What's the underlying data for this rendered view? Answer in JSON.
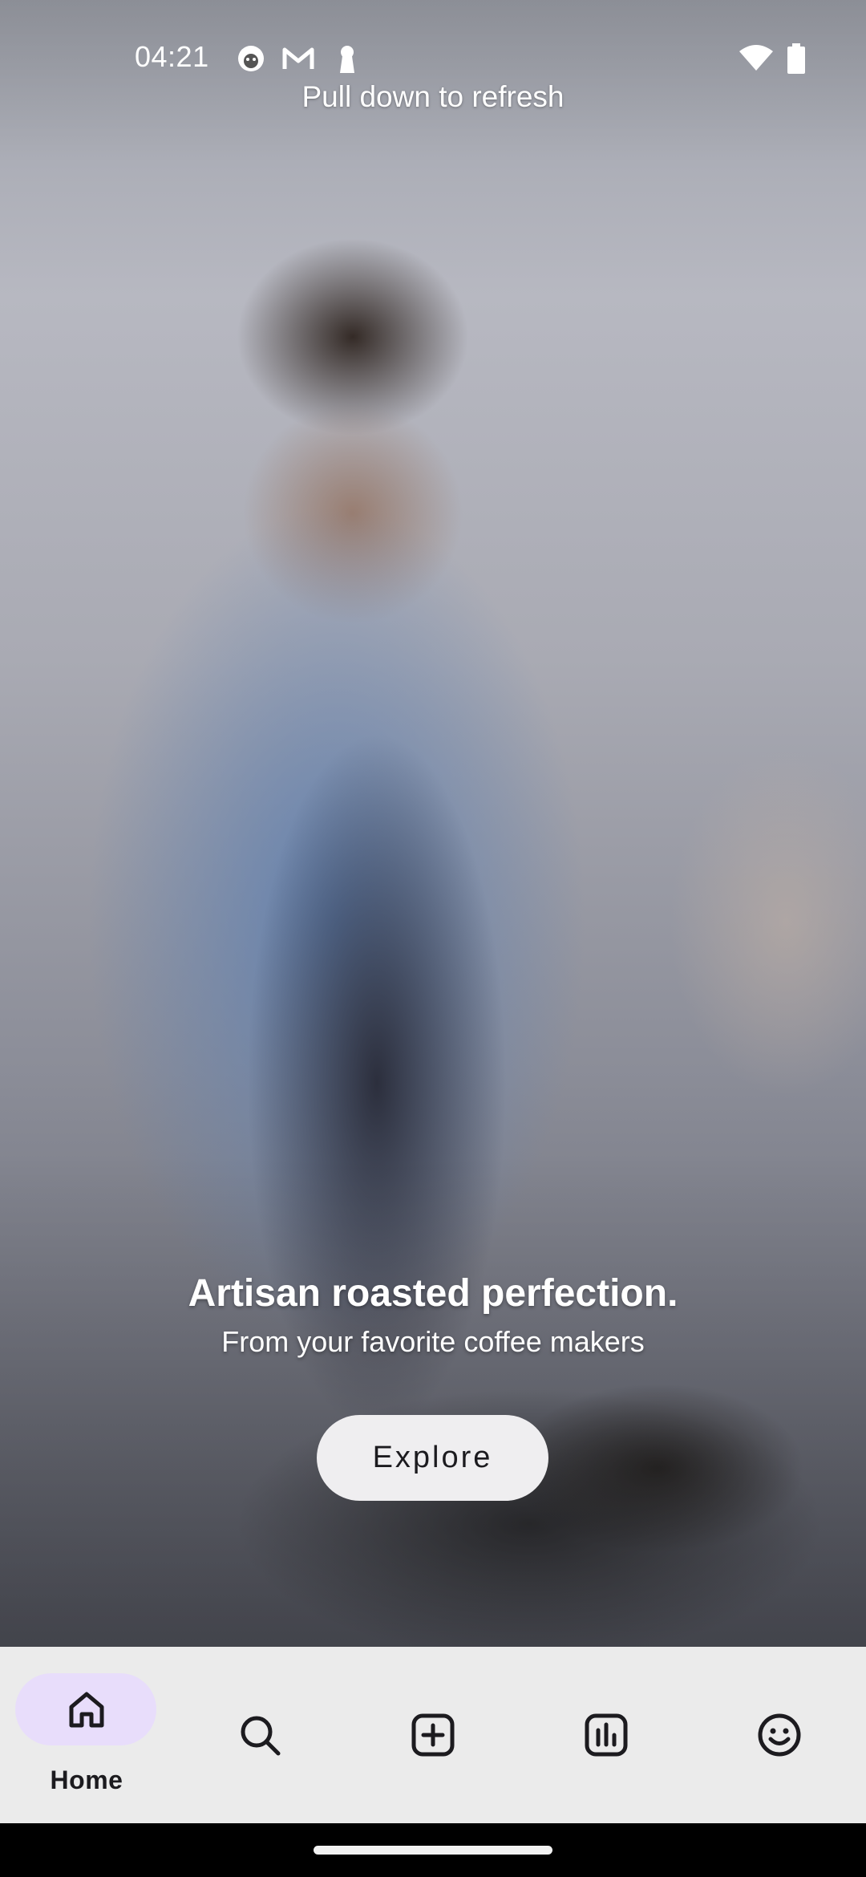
{
  "status_bar": {
    "time": "04:21",
    "icons": [
      "app-notification-icon",
      "gmail-icon",
      "keyhole-icon",
      "wifi-icon",
      "battery-icon"
    ]
  },
  "refresh_hint": "Pull down to refresh",
  "hero": {
    "title": "Artisan roasted perfection.",
    "subtitle": "From your favorite coffee makers",
    "button_label": "Explore"
  },
  "bottom_nav": {
    "items": [
      {
        "label": "Home",
        "icon": "home-icon",
        "selected": true
      },
      {
        "label": "",
        "icon": "search-icon",
        "selected": false
      },
      {
        "label": "",
        "icon": "add-box-icon",
        "selected": false
      },
      {
        "label": "",
        "icon": "chart-icon",
        "selected": false
      },
      {
        "label": "",
        "icon": "smiley-icon",
        "selected": false
      }
    ]
  },
  "colors": {
    "nav_background": "#ebebeb",
    "selected_pill": "#e8ddfb",
    "button_background": "#efeef0",
    "text_dark": "#1c1b1f"
  }
}
